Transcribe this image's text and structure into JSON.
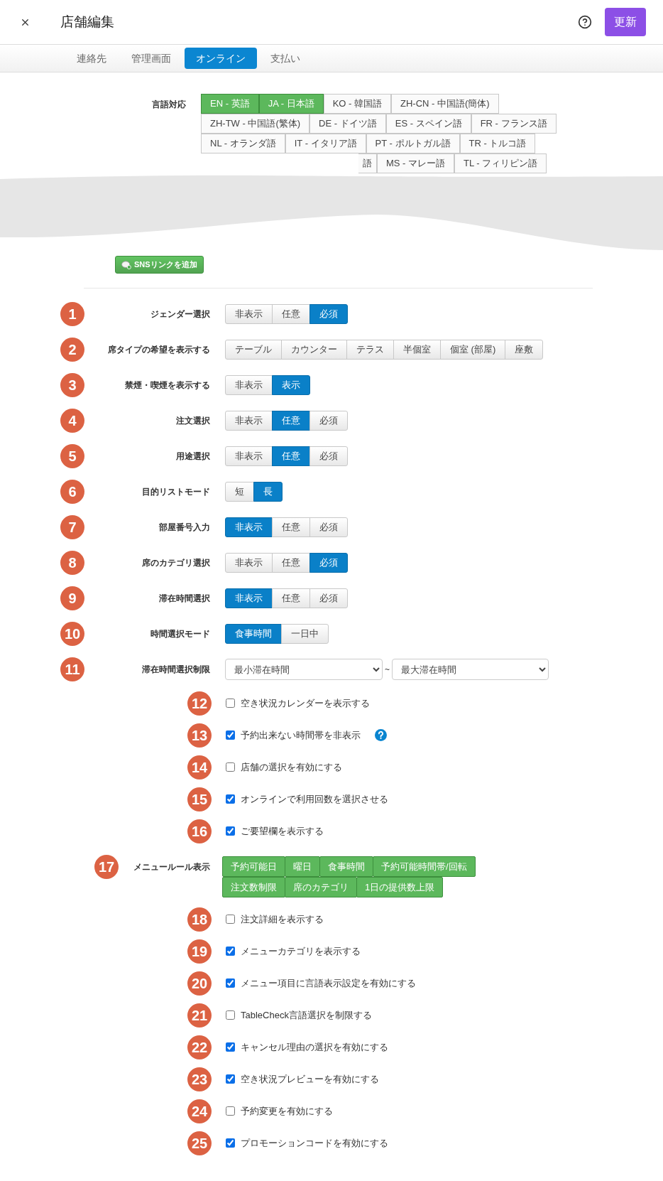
{
  "header": {
    "title": "店舗編集",
    "update_button": "更新"
  },
  "tabs": [
    {
      "label": "連絡先",
      "selected": false
    },
    {
      "label": "管理画面",
      "selected": false
    },
    {
      "label": "オンライン",
      "selected": true
    },
    {
      "label": "支払い",
      "selected": false
    }
  ],
  "languages": {
    "label": "言語対応",
    "options": [
      {
        "label": "EN - 英語",
        "selected": true,
        "partial": false
      },
      {
        "label": "JA - 日本語",
        "selected": true,
        "partial": false
      },
      {
        "label": "KO - 韓国語",
        "selected": false,
        "partial": false
      },
      {
        "label": "ZH-CN - 中国語(簡体)",
        "selected": false,
        "partial": false
      },
      {
        "label": "ZH-TW - 中国語(繁体)",
        "selected": false,
        "partial": false
      },
      {
        "label": "DE - ドイツ語",
        "selected": false,
        "partial": false
      },
      {
        "label": "ES - スペイン語",
        "selected": false,
        "partial": false
      },
      {
        "label": "FR - フランス語",
        "selected": false,
        "partial": false
      },
      {
        "label": "NL - オランダ語",
        "selected": false,
        "partial": false
      },
      {
        "label": "IT - イタリア語",
        "selected": false,
        "partial": false
      },
      {
        "label": "PT - ポルトガル語",
        "selected": false,
        "partial": false
      },
      {
        "label": "TR - トルコ語",
        "selected": false,
        "partial": false
      },
      {
        "label": "語",
        "selected": false,
        "partial": true
      },
      {
        "label": "MS - マレー語",
        "selected": false,
        "partial": false
      },
      {
        "label": "TL - フィリピン語",
        "selected": false,
        "partial": false
      }
    ]
  },
  "sns_button": "SNSリンクを追加",
  "settings": [
    {
      "badge": "1",
      "kind": "segmented",
      "label": "ジェンダー選択",
      "options": [
        {
          "label": "非表示",
          "selected": false
        },
        {
          "label": "任意",
          "selected": false
        },
        {
          "label": "必須",
          "selected": true
        }
      ]
    },
    {
      "badge": "2",
      "kind": "segmented",
      "label": "席タイプの希望を表示する",
      "options": [
        {
          "label": "テーブル",
          "selected": false
        },
        {
          "label": "カウンター",
          "selected": false
        },
        {
          "label": "テラス",
          "selected": false
        },
        {
          "label": "半個室",
          "selected": false
        },
        {
          "label": "個室 (部屋)",
          "selected": false
        },
        {
          "label": "座敷",
          "selected": false
        }
      ]
    },
    {
      "badge": "3",
      "kind": "segmented",
      "label": "禁煙・喫煙を表示する",
      "options": [
        {
          "label": "非表示",
          "selected": false
        },
        {
          "label": "表示",
          "selected": true
        }
      ]
    },
    {
      "badge": "4",
      "kind": "segmented",
      "label": "注文選択",
      "options": [
        {
          "label": "非表示",
          "selected": false
        },
        {
          "label": "任意",
          "selected": true
        },
        {
          "label": "必須",
          "selected": false
        }
      ]
    },
    {
      "badge": "5",
      "kind": "segmented",
      "label": "用途選択",
      "options": [
        {
          "label": "非表示",
          "selected": false
        },
        {
          "label": "任意",
          "selected": true
        },
        {
          "label": "必須",
          "selected": false
        }
      ]
    },
    {
      "badge": "6",
      "kind": "segmented",
      "label": "目的リストモード",
      "options": [
        {
          "label": "短",
          "selected": false
        },
        {
          "label": "長",
          "selected": true
        }
      ]
    },
    {
      "badge": "7",
      "kind": "segmented",
      "label": "部屋番号入力",
      "options": [
        {
          "label": "非表示",
          "selected": true
        },
        {
          "label": "任意",
          "selected": false
        },
        {
          "label": "必須",
          "selected": false
        }
      ]
    },
    {
      "badge": "8",
      "kind": "segmented",
      "label": "席のカテゴリ選択",
      "options": [
        {
          "label": "非表示",
          "selected": false
        },
        {
          "label": "任意",
          "selected": false
        },
        {
          "label": "必須",
          "selected": true
        }
      ]
    },
    {
      "badge": "9",
      "kind": "segmented",
      "label": "滞在時間選択",
      "options": [
        {
          "label": "非表示",
          "selected": true
        },
        {
          "label": "任意",
          "selected": false
        },
        {
          "label": "必須",
          "selected": false
        }
      ]
    },
    {
      "badge": "10",
      "kind": "segmented",
      "label": "時間選択モード",
      "options": [
        {
          "label": "食事時間",
          "selected": true
        },
        {
          "label": "一日中",
          "selected": false
        }
      ]
    },
    {
      "badge": "11",
      "kind": "range",
      "label": "滞在時間選択制限",
      "min": "最小滞在時間",
      "separator": "~",
      "max": "最大滞在時間"
    },
    {
      "badge": "12",
      "kind": "checkbox",
      "label": "空き状況カレンダーを表示する",
      "checked": false
    },
    {
      "badge": "13",
      "kind": "checkbox",
      "label": "予約出来ない時間帯を非表示",
      "checked": true,
      "help": true
    },
    {
      "badge": "14",
      "kind": "checkbox",
      "label": "店舗の選択を有効にする",
      "checked": false
    },
    {
      "badge": "15",
      "kind": "checkbox",
      "label": "オンラインで利用回数を選択させる",
      "checked": true
    },
    {
      "badge": "16",
      "kind": "checkbox",
      "label": "ご要望欄を表示する",
      "checked": true
    },
    {
      "badge": "17",
      "kind": "chips",
      "label": "メニュールール表示",
      "chips": [
        "予約可能日",
        "曜日",
        "食事時間",
        "予約可能時間帯/回転",
        "注文数制限",
        "席のカテゴリ",
        "1日の提供数上限"
      ]
    },
    {
      "badge": "18",
      "kind": "checkbox",
      "label": "注文詳細を表示する",
      "checked": false
    },
    {
      "badge": "19",
      "kind": "checkbox",
      "label": "メニューカテゴリを表示する",
      "checked": true
    },
    {
      "badge": "20",
      "kind": "checkbox",
      "label": "メニュー項目に言語表示設定を有効にする",
      "checked": true
    },
    {
      "badge": "21",
      "kind": "checkbox",
      "label": "TableCheck言語選択を制限する",
      "checked": false
    },
    {
      "badge": "22",
      "kind": "checkbox",
      "label": "キャンセル理由の選択を有効にする",
      "checked": true
    },
    {
      "badge": "23",
      "kind": "checkbox",
      "label": "空き状況プレビューを有効にする",
      "checked": true
    },
    {
      "badge": "24",
      "kind": "checkbox",
      "label": "予約変更を有効にする",
      "checked": false
    },
    {
      "badge": "25",
      "kind": "checkbox",
      "label": "プロモーションコードを有効にする",
      "checked": true
    }
  ]
}
